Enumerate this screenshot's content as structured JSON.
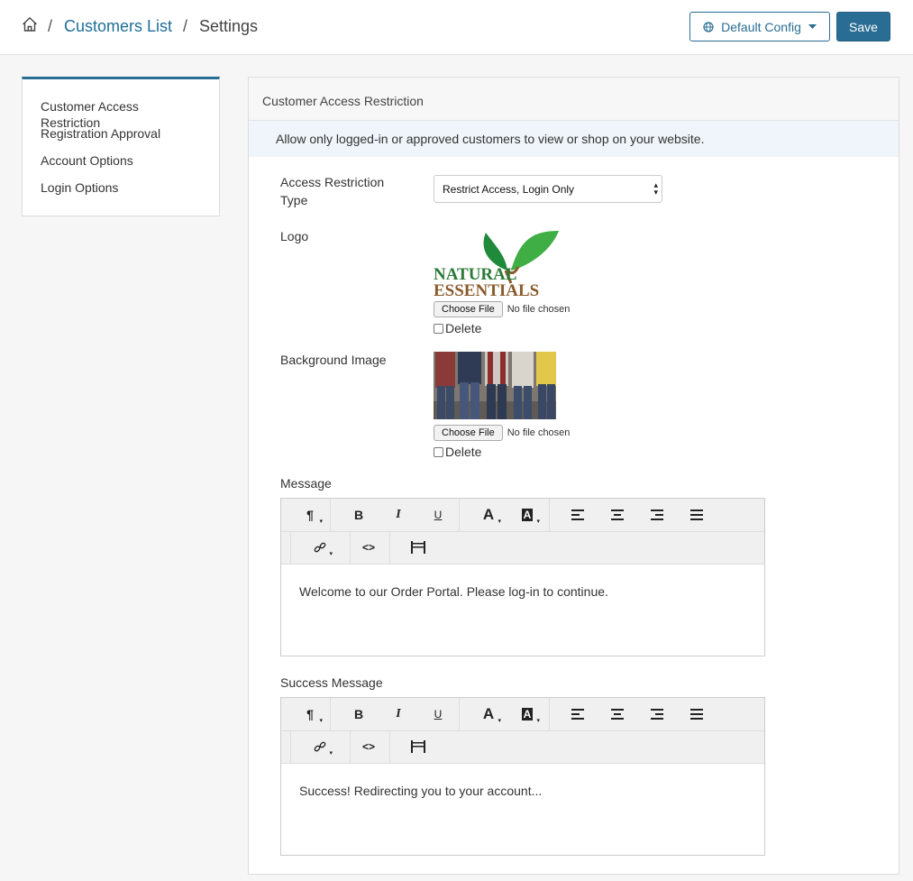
{
  "breadcrumb": {
    "home_icon": "home-icon",
    "separator": "/",
    "link": "Customers List",
    "current": "Settings"
  },
  "header": {
    "config_label": "Default Config",
    "config_icon": "globe-icon",
    "save_label": "Save"
  },
  "sidebar": {
    "items": [
      {
        "label": "Customer Access Restriction"
      },
      {
        "label": "Registration Approval"
      },
      {
        "label": "Account Options"
      },
      {
        "label": "Login Options"
      }
    ]
  },
  "panel": {
    "title": "Customer Access Restriction",
    "info": "Allow only logged-in or approved customers to view or shop on your website."
  },
  "access": {
    "label_line1": "Access Restriction",
    "label_line2": "Type",
    "selected": "Restrict Access, Login Only"
  },
  "logo": {
    "label": "Logo",
    "brand_line1": "NATURAL",
    "brand_line2": "ESSENTIALS",
    "choose_label": "Choose File",
    "no_file": "No file chosen",
    "delete_label": "Delete"
  },
  "background": {
    "label": "Background Image",
    "choose_label": "Choose File",
    "no_file": "No file chosen",
    "delete_label": "Delete"
  },
  "message": {
    "label": "Message",
    "content": "Welcome to our Order Portal. Please log-in to continue."
  },
  "success": {
    "label": "Success Message",
    "content": "Success! Redirecting you to your account..."
  },
  "toolbar": {
    "paragraph": "¶",
    "bold": "B",
    "italic": "I",
    "underline": "U",
    "font_color": "A",
    "bg_color": "A",
    "code": "<>"
  },
  "colors": {
    "accent": "#2a6d94",
    "link": "#1f6f97",
    "info_bg": "#eff5fa",
    "leaf_dark": "#1f8a3a",
    "leaf_light": "#3fae45",
    "brand_green": "#2b7a37",
    "brand_brown": "#8b5a2b"
  }
}
